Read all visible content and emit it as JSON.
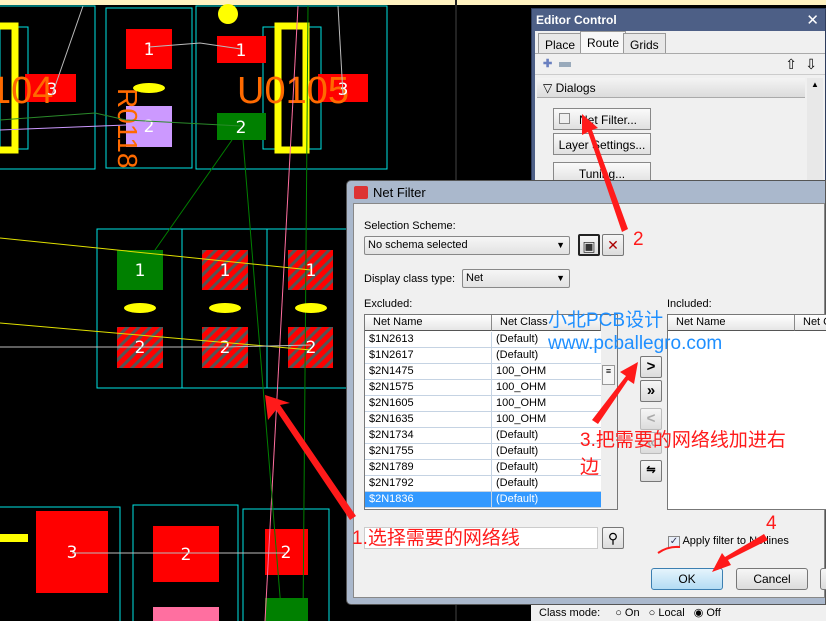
{
  "pcb": {
    "refdes": [
      "104",
      "3",
      "U0105",
      "3",
      "1",
      "2",
      "1",
      "2",
      "1",
      "1",
      "2",
      "2",
      "2",
      "3",
      "2",
      "2"
    ],
    "colors": {
      "background": "#000000",
      "outline": "#00e5e5",
      "pad_red": "#ff0000",
      "pad_green": "#008000",
      "pad_purple": "#cc99ff",
      "silk": "#ff6a00",
      "yellow": "#ffff00"
    }
  },
  "editor_control": {
    "title": "Editor Control",
    "close": "✕",
    "tabs": [
      {
        "label": "Place"
      },
      {
        "label": "Route"
      },
      {
        "label": "Grids"
      }
    ],
    "active_tab": "Route",
    "section": "Dialogs",
    "buttons": [
      {
        "label": "Net Filter..."
      },
      {
        "label": "Layer Settings..."
      },
      {
        "label": "Tuning..."
      }
    ],
    "class_mode": {
      "label": "Class mode:",
      "options": [
        "On",
        "Local",
        "Off"
      ],
      "selected": "Off"
    }
  },
  "net_filter": {
    "title": "Net Filter",
    "selection_scheme_label": "Selection Scheme:",
    "selection_scheme_value": "No schema selected",
    "display_class_label": "Display class type:",
    "display_class_value": "Net",
    "excluded_label": "Excluded:",
    "included_label": "Included:",
    "columns": [
      "Net Name",
      "Net Class"
    ],
    "included_columns": [
      "Net Name",
      "Net C"
    ],
    "rows": [
      [
        "$1N2613",
        "(Default)"
      ],
      [
        "$1N2617",
        "(Default)"
      ],
      [
        "$2N1475",
        "100_OHM"
      ],
      [
        "$2N1575",
        "100_OHM"
      ],
      [
        "$2N1605",
        "100_OHM"
      ],
      [
        "$2N1635",
        "100_OHM"
      ],
      [
        "$2N1734",
        "(Default)"
      ],
      [
        "$2N1755",
        "(Default)"
      ],
      [
        "$2N1789",
        "(Default)"
      ],
      [
        "$2N1792",
        "(Default)"
      ],
      [
        "$2N1836",
        "(Default)"
      ]
    ],
    "selected_row": "$2N1836",
    "search_value": "",
    "apply_filter_label": "Apply filter to Netlines",
    "apply_filter_checked": true,
    "ok": "OK",
    "cancel": "Cancel"
  },
  "annotations": {
    "step1": "1.选择需要的网络线",
    "step2": "2",
    "step3a": "3.把需要的网络线加进右",
    "step3b": "边",
    "step4": "4",
    "color": "#ff1a1a"
  },
  "watermark": {
    "line1": "小北PCB设计",
    "line2": "www.pcballegro.com",
    "color": "#1e8fff"
  }
}
